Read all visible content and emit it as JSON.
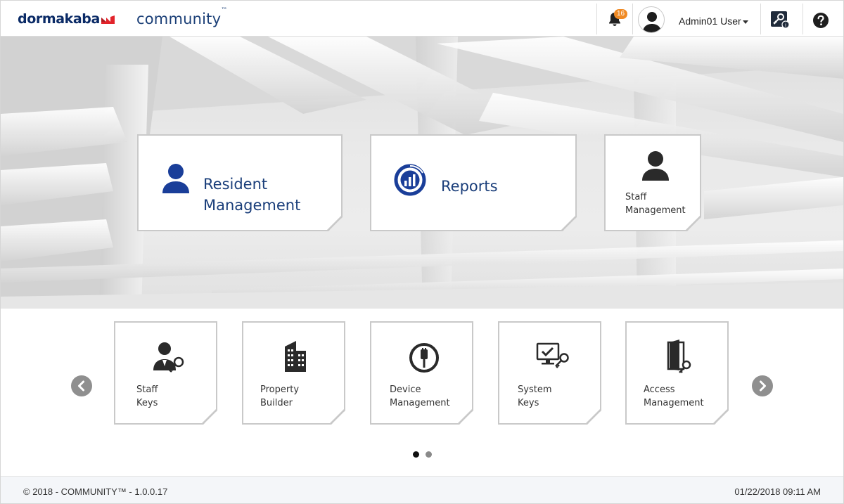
{
  "header": {
    "brand_text": "dormakaba",
    "product_name": "community",
    "product_tm": "™",
    "notification_count": "16",
    "user_label": "Admin01 User",
    "colors": {
      "brand": "#0a2a66",
      "accent_red": "#e2232a",
      "badge": "#f08a24"
    }
  },
  "main_tiles": [
    {
      "line1": "Resident",
      "line2": "Management",
      "icon": "resident-user-icon"
    },
    {
      "line1": "Reports",
      "line2": "",
      "icon": "reports-chart-icon"
    },
    {
      "line1": "Staff",
      "line2": "Management",
      "icon": "staff-user-icon"
    }
  ],
  "carousel": {
    "tiles": [
      {
        "line1": "Staff",
        "line2": "Keys",
        "icon": "staff-keys-icon"
      },
      {
        "line1": "Property",
        "line2": "Builder",
        "icon": "building-icon"
      },
      {
        "line1": "Device",
        "line2": "Management",
        "icon": "usb-device-icon"
      },
      {
        "line1": "System",
        "line2": "Keys",
        "icon": "system-keys-icon"
      },
      {
        "line1": "Access",
        "line2": "Management",
        "icon": "door-key-icon"
      }
    ],
    "pages": 2,
    "active_page": 1
  },
  "footer": {
    "copyright": "© 2018 - COMMUNITY™ - 1.0.0.17",
    "datetime": "01/22/2018 09:11 AM"
  }
}
